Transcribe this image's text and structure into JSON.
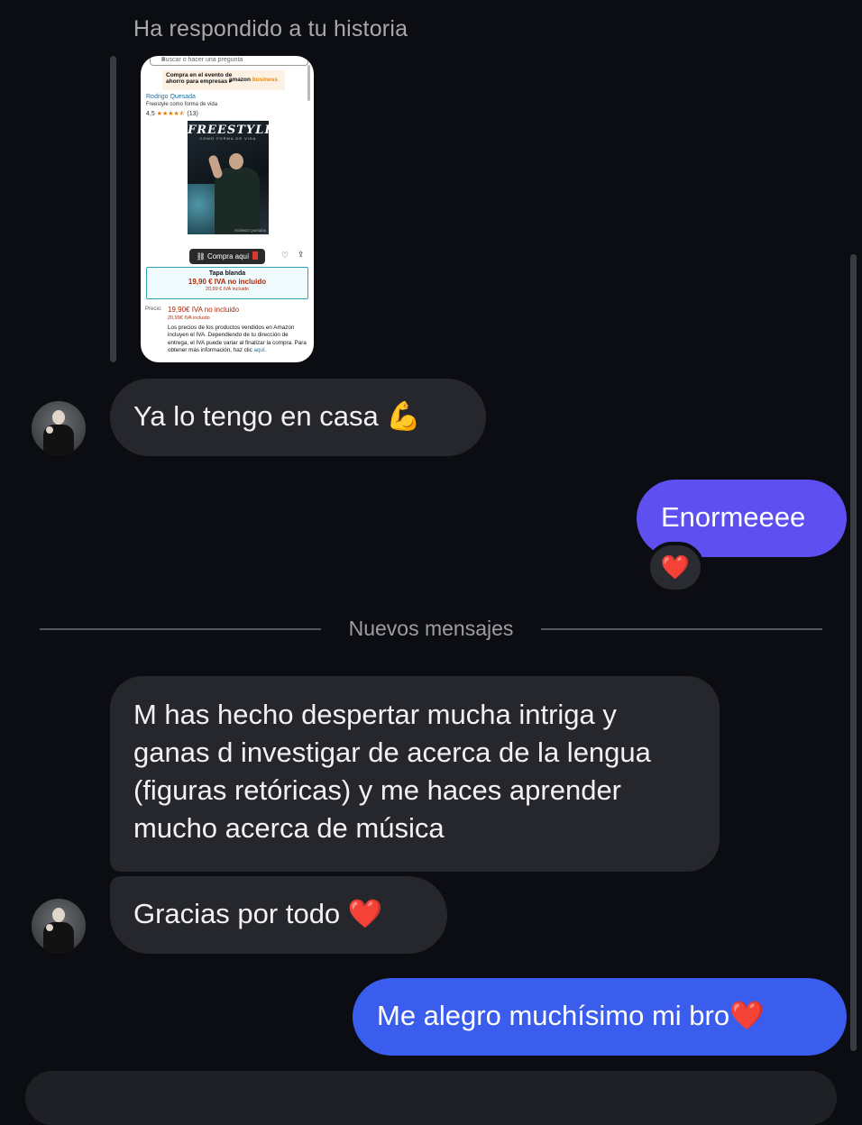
{
  "reply_label": "Ha respondido a tu historia",
  "story": {
    "search_placeholder": "Buscar o hacer una pregunta",
    "banner_text": "Compra en el evento de ahorro para empresas ▸",
    "banner_brand": "amazon",
    "banner_brand_suffix": "business",
    "author": "Rodrigo Quesada",
    "subtitle": "Freestyle como forma de vida",
    "rating_value": "4,5",
    "rating_stars": "★★★★⯪",
    "rating_count": "(13)",
    "cover_title": "FREESTYLE",
    "cover_subtitle": "COMO FORMA DE VIDA",
    "cover_author": "RODRIGO QUESADA",
    "buy_label": "Compra aquí",
    "format_name": "Tapa blanda",
    "format_price": "19,90 € IVA no incluido",
    "format_price_iva": "20,99 € IVA incluido",
    "price_label": "Precio:",
    "price": "19,90€ IVA no incluido",
    "price_iva": "20,99€ IVA incluido",
    "legal_text": "Los precios de los productos vendidos en Amazon incluyen el IVA. Dependiendo de tu dirección de entrega, el IVA puede variar al finalizar la compra. Para obtener más información, haz clic ",
    "legal_link": "aquí."
  },
  "messages": {
    "m1": {
      "text": "Ya lo tengo en casa ",
      "emoji": "💪"
    },
    "m2": {
      "text": "Enormeeee",
      "reaction": "❤️"
    },
    "m3": {
      "text": "M has hecho despertar mucha intriga y ganas d investigar de acerca de la lengua (figuras retóricas) y me haces aprender mucho acerca de música"
    },
    "m4": {
      "text": "Gracias por todo ",
      "emoji": "❤️"
    },
    "m5": {
      "text": "Me alegro muchísimo mi bro",
      "emoji": "❤️"
    }
  },
  "divider_label": "Nuevos mensajes",
  "colors": {
    "background": "#0c0d12",
    "incoming_bubble": "#26272c",
    "outgoing_purple": "#5d4ff0",
    "outgoing_blue": "#3a5ded"
  }
}
